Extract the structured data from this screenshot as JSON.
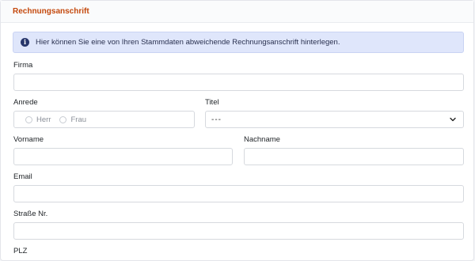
{
  "section": {
    "title": "Rechnungsanschrift"
  },
  "alert": {
    "icon": "info-icon",
    "text": "Hier können Sie eine von Ihren Stammdaten abweichende Rechnungsanschrift hinterlegen."
  },
  "form": {
    "firma": {
      "label": "Firma",
      "value": ""
    },
    "anrede": {
      "label": "Anrede",
      "options": [
        "Herr",
        "Frau"
      ]
    },
    "titel": {
      "label": "Titel",
      "selected": "---"
    },
    "vorname": {
      "label": "Vorname",
      "value": ""
    },
    "nachname": {
      "label": "Nachname",
      "value": ""
    },
    "email": {
      "label": "Email",
      "value": ""
    },
    "strasse": {
      "label": "Straße Nr.",
      "value": ""
    },
    "plz": {
      "label": "PLZ"
    }
  },
  "colors": {
    "accent": "#c4480c",
    "alert_bg": "#dfe6fb",
    "info_icon": "#27366b"
  }
}
